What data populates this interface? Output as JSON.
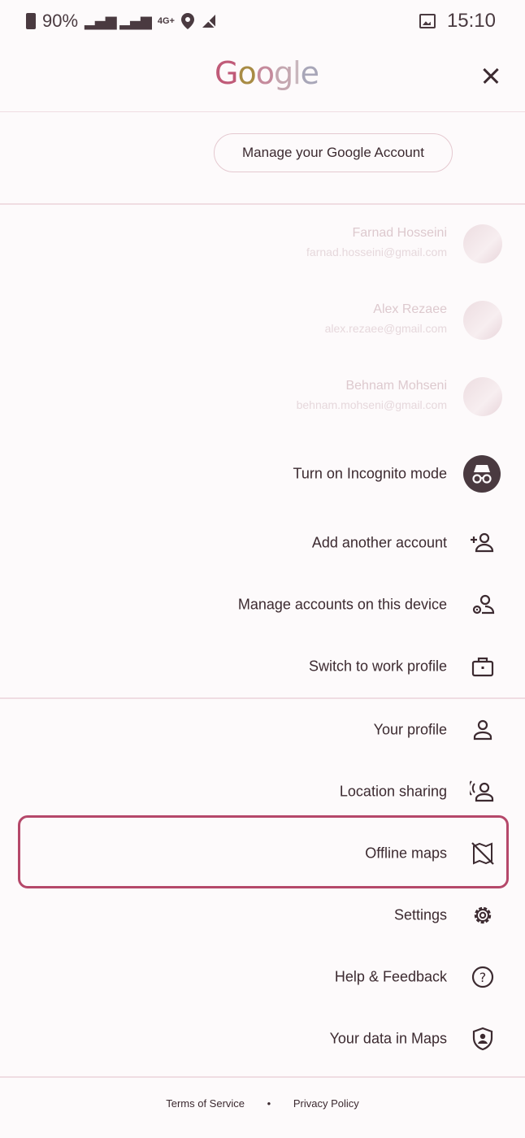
{
  "status_bar": {
    "battery": "90%",
    "network": "4G+",
    "time": "15:10"
  },
  "header": {
    "logo": "Google",
    "close_icon": "close-icon"
  },
  "manage_account_label": "Manage your Google Account",
  "accounts": [
    {
      "name": "Farnad Hosseini",
      "email": "farnad.hosseini@gmail.com"
    },
    {
      "name": "Alex Rezaee",
      "email": "alex.rezaee@gmail.com"
    },
    {
      "name": "Behnam Mohseni",
      "email": "behnam.mohseni@gmail.com"
    }
  ],
  "account_actions": {
    "incognito": "Turn on Incognito mode",
    "add_account": "Add another account",
    "manage_accounts": "Manage accounts on this device",
    "work_profile": "Switch to work profile"
  },
  "menu": {
    "your_profile": "Your profile",
    "location_sharing": "Location sharing",
    "offline_maps": "Offline maps",
    "settings": "Settings",
    "help": "Help & Feedback",
    "your_data": "Your data in Maps"
  },
  "footer": {
    "privacy": "Privacy Policy",
    "separator": "•",
    "terms": "Terms of Service"
  },
  "colors": {
    "accent": "#b5486a",
    "text": "#3c2a30",
    "divider": "#f0dde2"
  }
}
